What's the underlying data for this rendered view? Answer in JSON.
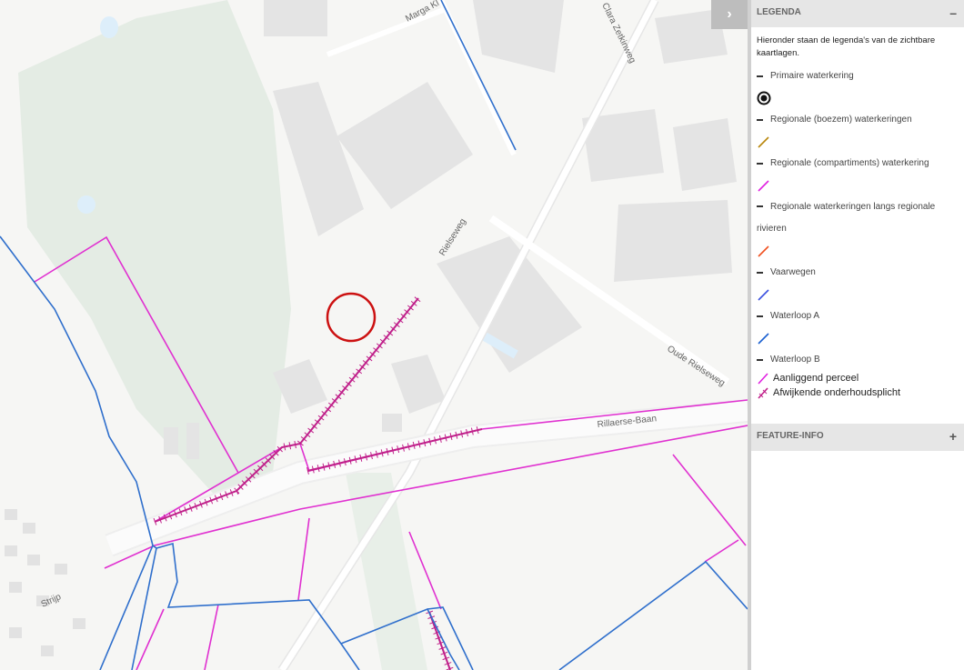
{
  "streets": {
    "marga": "Marga Kl",
    "zetkinweg": "Clara Zetkinweg",
    "rielseweg": "Rielseweg",
    "oude_rielseweg": "Oude Rielseweg",
    "rillaerse_baan": "Rillaerse-Baan",
    "strijp": "Strijp"
  },
  "panel": {
    "toggle_icon": "›",
    "legend_title": "LEGENDA",
    "legend_collapse": "–",
    "intro": "Hieronder staan de legenda's van de zichtbare kaartlagen.",
    "layers": [
      {
        "title": "Primaire waterkering",
        "symbol": "bullseye-icon",
        "color": "#111111"
      },
      {
        "title": "Regionale (boezem) waterkeringen",
        "symbol": "line",
        "color": "#b8860b"
      },
      {
        "title": "Regionale (compartiments) waterkering",
        "symbol": "line",
        "color": "#e020e0"
      },
      {
        "title": "Regionale waterkeringen langs regionale rivieren",
        "symbol": "line",
        "color": "#f05020"
      },
      {
        "title": "Vaarwegen",
        "symbol": "line",
        "color": "#3a50e0"
      },
      {
        "title": "Waterloop A",
        "symbol": "line",
        "color": "#1a60d0"
      }
    ],
    "waterloop_b": {
      "title": "Waterloop B",
      "items": [
        {
          "label": "Aanliggend perceel",
          "symbol": "line",
          "color": "#e020e0"
        },
        {
          "label": "Afwijkende onderhoudsplicht",
          "symbol": "tick-line",
          "color": "#c0208a"
        }
      ]
    },
    "feature_title": "FEATURE-INFO",
    "feature_expand": "+"
  },
  "colors": {
    "parcel": "#e030d0",
    "waterloop": "#2f6fcc",
    "marker": "#cc1111"
  }
}
